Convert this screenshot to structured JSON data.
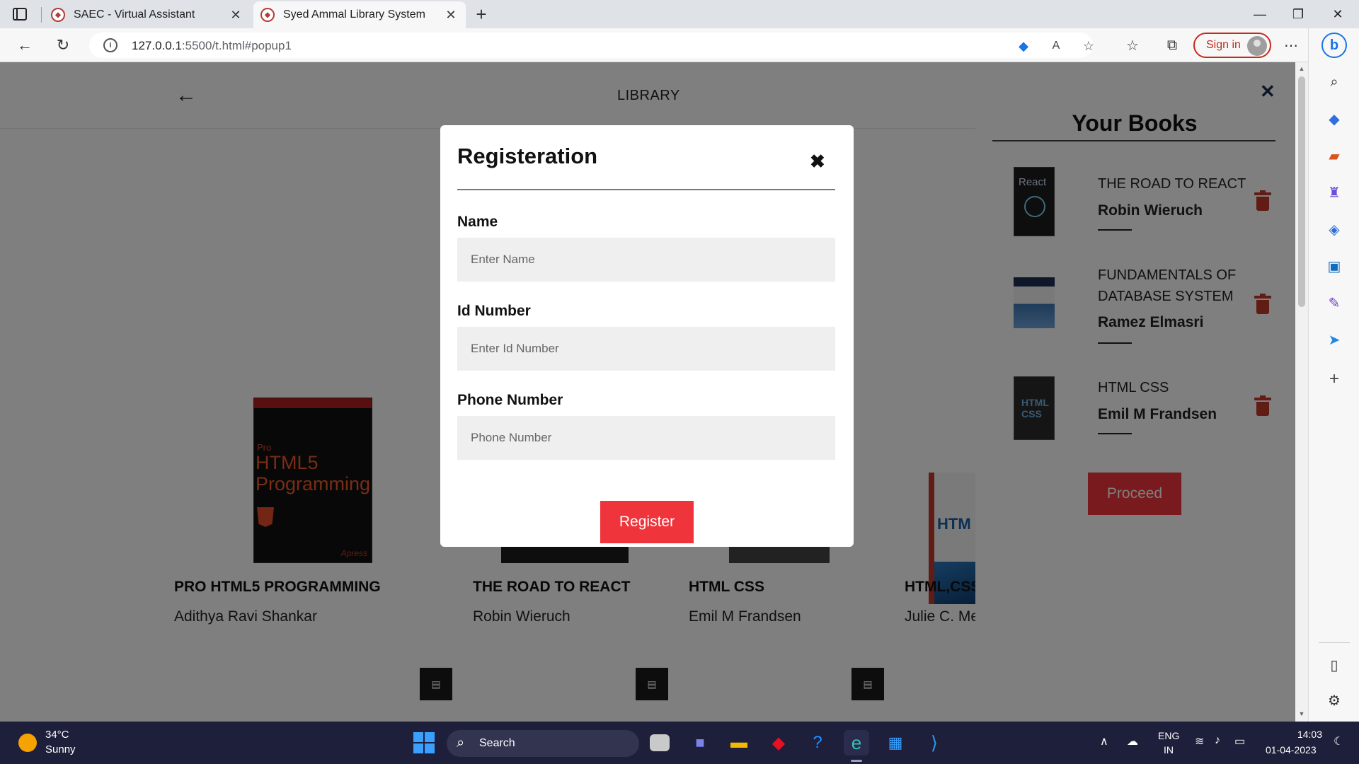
{
  "browser": {
    "tabs": [
      {
        "title": "SAEC - Virtual Assistant",
        "active": false
      },
      {
        "title": "Syed Ammal Library System",
        "active": true
      }
    ],
    "url_host": "127.0.0.1",
    "url_path": ":5500/t.html#popup1",
    "signin_label": "Sign in"
  },
  "page": {
    "header_title": "LIBRARY",
    "books": [
      {
        "title": "PRO HTML5 PROGRAMMING",
        "author": "Adithya Ravi Shankar"
      },
      {
        "title": "THE ROAD TO REACT",
        "author": "Robin Wieruch"
      },
      {
        "title": "HTML CSS",
        "author": "Emil M Frandsen"
      },
      {
        "title": "HTML,CSS",
        "author": "Julie C. Me"
      }
    ],
    "covers": {
      "html5_pro": "Pro",
      "html5_title": "HTML5 Programming",
      "html5_publisher": "Apress",
      "html5_badge": "5",
      "htmljs_title": "HTM"
    }
  },
  "side_panel": {
    "title": "Your Books",
    "items": [
      {
        "title": "THE ROAD TO REACT",
        "author": "Robin Wieruch",
        "cover_text": "React"
      },
      {
        "title": "FUNDAMENTALS OF DATABASE SYSTEM",
        "author": "Ramez Elmasri",
        "cover_text": ""
      },
      {
        "title": "HTML CSS",
        "author": "Emil M Frandsen",
        "cover_text": "HTML CSS"
      }
    ],
    "proceed_label": "Proceed"
  },
  "modal": {
    "title": "Registeration",
    "fields": [
      {
        "label": "Name",
        "placeholder": "Enter Name"
      },
      {
        "label": "Id Number",
        "placeholder": "Enter Id Number"
      },
      {
        "label": "Phone Number",
        "placeholder": "Phone Number"
      }
    ],
    "submit_label": "Register"
  },
  "taskbar": {
    "weather_temp": "34°C",
    "weather_desc": "Sunny",
    "search_label": "Search",
    "lang_top": "ENG",
    "lang_bottom": "IN",
    "time": "14:03",
    "date": "01-04-2023"
  },
  "colors": {
    "accent_red": "#f0343c",
    "trash_red": "#c0392b",
    "taskbar_bg": "#1e1f3a"
  }
}
